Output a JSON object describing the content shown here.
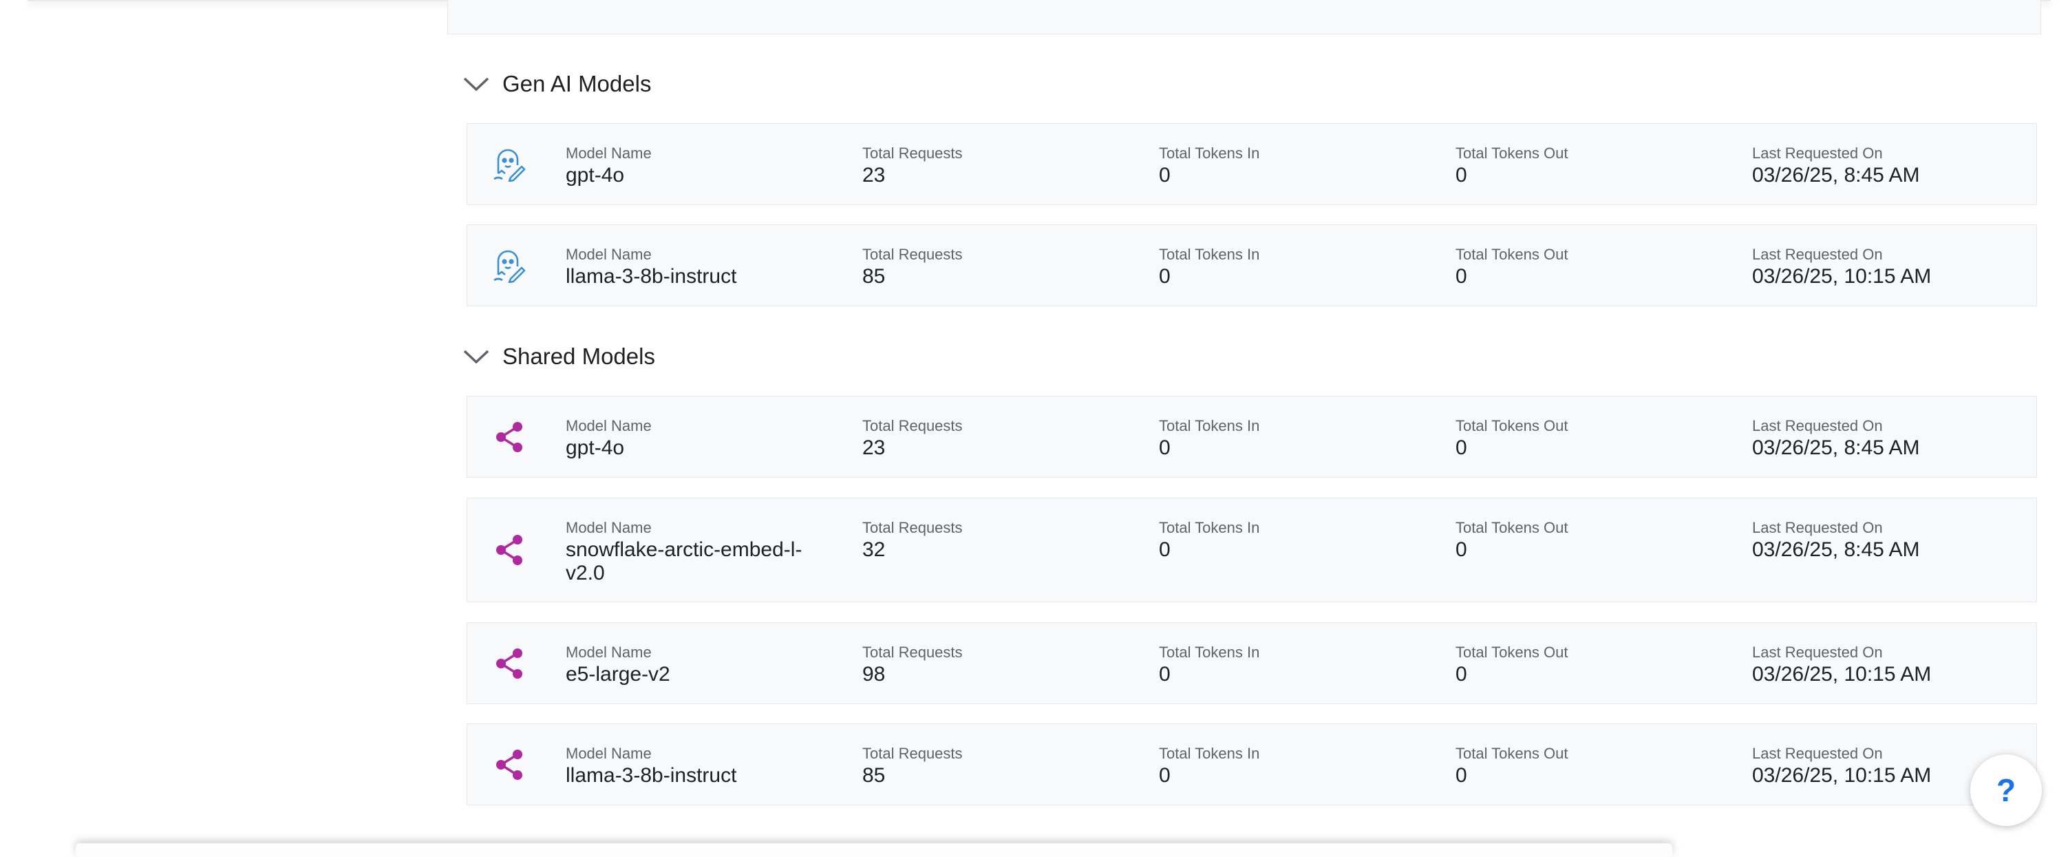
{
  "sections": [
    {
      "title": "Gen AI Models",
      "cards": [
        {
          "icon": "genai-model-icon",
          "model_name": "gpt-4o",
          "total_requests": "23",
          "tokens_in": "0",
          "tokens_out": "0",
          "last_requested": "03/26/25, 8:45 AM"
        },
        {
          "icon": "genai-model-icon",
          "model_name": "llama-3-8b-instruct",
          "total_requests": "85",
          "tokens_in": "0",
          "tokens_out": "0",
          "last_requested": "03/26/25, 10:15 AM"
        }
      ]
    },
    {
      "title": "Shared Models",
      "cards": [
        {
          "icon": "share-icon",
          "model_name": "gpt-4o",
          "total_requests": "23",
          "tokens_in": "0",
          "tokens_out": "0",
          "last_requested": "03/26/25, 8:45 AM"
        },
        {
          "icon": "share-icon",
          "model_name": "snowflake-arctic-embed-l-v2.0",
          "total_requests": "32",
          "tokens_in": "0",
          "tokens_out": "0",
          "last_requested": "03/26/25, 8:45 AM"
        },
        {
          "icon": "share-icon",
          "model_name": "e5-large-v2",
          "total_requests": "98",
          "tokens_in": "0",
          "tokens_out": "0",
          "last_requested": "03/26/25, 10:15 AM"
        },
        {
          "icon": "share-icon",
          "model_name": "llama-3-8b-instruct",
          "total_requests": "85",
          "tokens_in": "0",
          "tokens_out": "0",
          "last_requested": "03/26/25, 10:15 AM"
        }
      ]
    }
  ],
  "labels": {
    "model_name": "Model Name",
    "total_requests": "Total Requests",
    "tokens_in": "Total Tokens In",
    "tokens_out": "Total Tokens Out",
    "last_requested": "Last Requested On"
  },
  "help": {
    "label": "?"
  },
  "colors": {
    "genai_icon": "#3a8fd6",
    "share_icon": "#b0299f",
    "help_accent": "#1a73e8"
  }
}
